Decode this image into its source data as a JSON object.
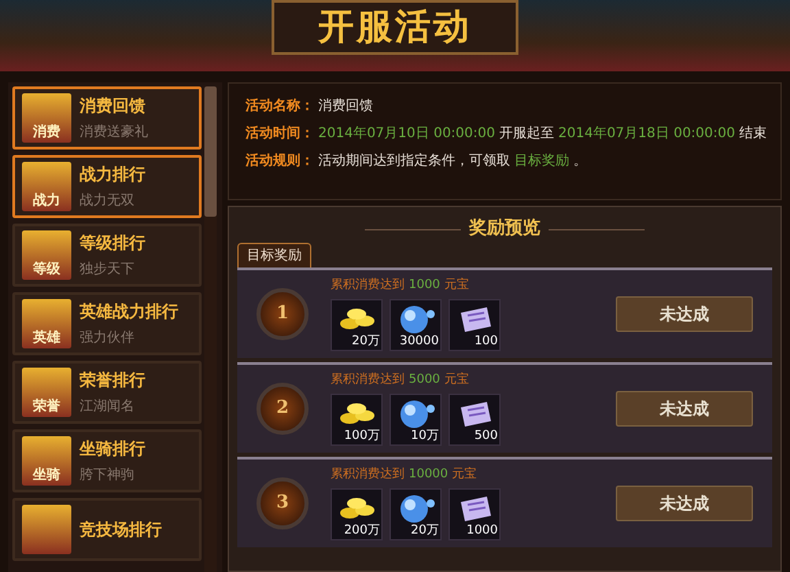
{
  "title": "开服活动",
  "sidebar": {
    "items": [
      {
        "badge": "消费",
        "name": "消费回馈",
        "subtitle": "消费送豪礼",
        "selected": true
      },
      {
        "badge": "战力",
        "name": "战力排行",
        "subtitle": "战力无双",
        "selected": true
      },
      {
        "badge": "等级",
        "name": "等级排行",
        "subtitle": "独步天下",
        "selected": false
      },
      {
        "badge": "英雄",
        "name": "英雄战力排行",
        "subtitle": "强力伙伴",
        "selected": false
      },
      {
        "badge": "荣誉",
        "name": "荣誉排行",
        "subtitle": "江湖闻名",
        "selected": false
      },
      {
        "badge": "坐骑",
        "name": "坐骑排行",
        "subtitle": "胯下神驹",
        "selected": false
      },
      {
        "name": "竞技场排行",
        "selected": false
      }
    ]
  },
  "info": [
    {
      "label": "活动名称：",
      "parts": [
        {
          "text": "消费回馈",
          "kind": "plain"
        }
      ]
    },
    {
      "label": "活动时间：",
      "parts": [
        {
          "text": "2014年07月10日  00:00:00",
          "kind": "green"
        },
        {
          "text": "开服起至",
          "kind": "plain"
        },
        {
          "text": "2014年07月18日  00:00:00",
          "kind": "green"
        },
        {
          "text": "结束",
          "kind": "plain"
        }
      ]
    },
    {
      "label": "活动规则：",
      "parts": [
        {
          "text": "活动期间达到指定条件，可领取",
          "kind": "plain"
        },
        {
          "text": "目标奖励",
          "kind": "green"
        },
        {
          "text": "。",
          "kind": "plain"
        }
      ]
    }
  ],
  "rewards": {
    "title": "奖励预览",
    "tabs": [
      {
        "label": "目标奖励",
        "selected": true
      }
    ],
    "rows": [
      {
        "rank": "1",
        "prefix": "累积消费达到",
        "amount": "1000",
        "unit": "元宝",
        "items": [
          {
            "kind": "gold",
            "count": "20万"
          },
          {
            "kind": "orb",
            "count": "30000"
          },
          {
            "kind": "scroll",
            "count": "100"
          }
        ],
        "button": "未达成",
        "disabled": true
      },
      {
        "rank": "2",
        "prefix": "累积消费达到",
        "amount": "5000",
        "unit": "元宝",
        "items": [
          {
            "kind": "gold",
            "count": "100万"
          },
          {
            "kind": "orb",
            "count": "10万"
          },
          {
            "kind": "scroll",
            "count": "500"
          }
        ],
        "button": "未达成",
        "disabled": true
      },
      {
        "rank": "3",
        "prefix": "累积消费达到",
        "amount": "10000",
        "unit": "元宝",
        "items": [
          {
            "kind": "gold",
            "count": "200万"
          },
          {
            "kind": "orb",
            "count": "20万"
          },
          {
            "kind": "scroll",
            "count": "1000"
          }
        ],
        "button": "未达成",
        "disabled": true
      }
    ]
  }
}
